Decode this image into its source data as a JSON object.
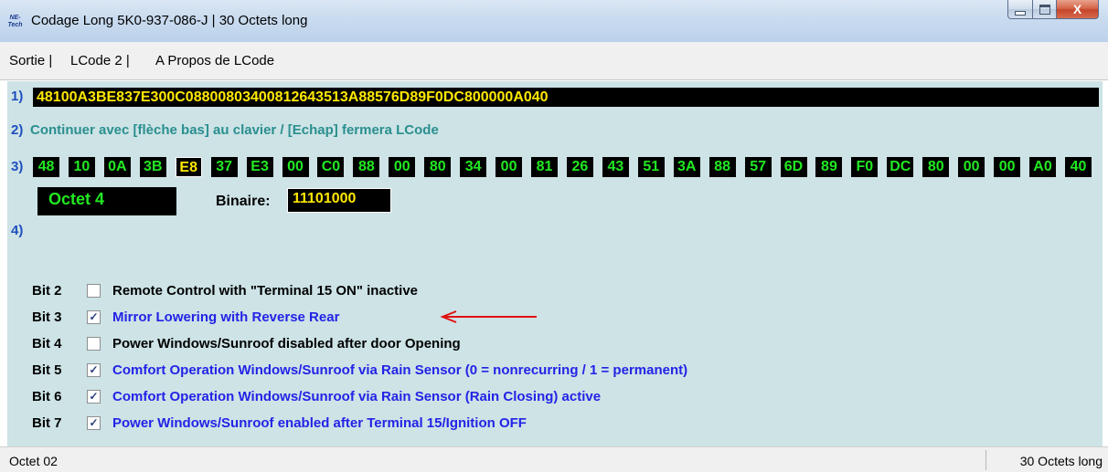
{
  "window": {
    "icon_text": "NE-Tech",
    "title": "Codage Long  5K0-937-086-J | 30 Octets long",
    "close_glyph": "X"
  },
  "menu": {
    "items": [
      "Sortie |",
      "LCode 2 |",
      "A Propos de LCode"
    ]
  },
  "section1": {
    "num": "1)",
    "hex": "48100A3BE837E300C0880080340081264351 3A88576D89F0DC800000A040"
  },
  "section2": {
    "num": "2)",
    "text": "Continuer avec [flèche bas] au clavier / [Echap] fermera LCode"
  },
  "section3": {
    "num": "3)",
    "bytes": [
      "48",
      "10",
      "0A",
      "3B",
      "E8",
      "37",
      "E3",
      "00",
      "C0",
      "88",
      "00",
      "80",
      "34",
      "00",
      "81",
      "26",
      "43",
      "51",
      "3A",
      "88",
      "57",
      "6D",
      "89",
      "F0",
      "DC",
      "80",
      "00",
      "00",
      "A0",
      "40"
    ],
    "selected_index": 4,
    "octet_label": "Octet 4",
    "binaire_label": "Binaire:",
    "binaire_value": "11101000"
  },
  "section4": {
    "num": "4)",
    "bits": [
      {
        "label": "Bit 2",
        "checked": false,
        "text": "Remote Control with \"Terminal 15 ON\" inactive"
      },
      {
        "label": "Bit 3",
        "checked": true,
        "text": "Mirror Lowering with Reverse Rear"
      },
      {
        "label": "Bit 4",
        "checked": false,
        "text": "Power Windows/Sunroof disabled after door Opening"
      },
      {
        "label": "Bit 5",
        "checked": true,
        "text": "Comfort Operation Windows/Sunroof via Rain Sensor (0 = nonrecurring / 1 = permanent)"
      },
      {
        "label": "Bit 6",
        "checked": true,
        "text": "Comfort Operation Windows/Sunroof via Rain Sensor (Rain Closing) active"
      },
      {
        "label": "Bit 7",
        "checked": true,
        "text": "Power Windows/Sunroof enabled after Terminal 15/Ignition OFF"
      }
    ],
    "check_glyph": "✓"
  },
  "status": {
    "left": "Octet 02",
    "right": "30 Octets long"
  },
  "colors": {
    "content_bg": "#cde3e6",
    "hex_text": "#ffe800",
    "byte_text": "#22e822",
    "checked_text": "#2323e6",
    "arrow": "#e01010"
  }
}
